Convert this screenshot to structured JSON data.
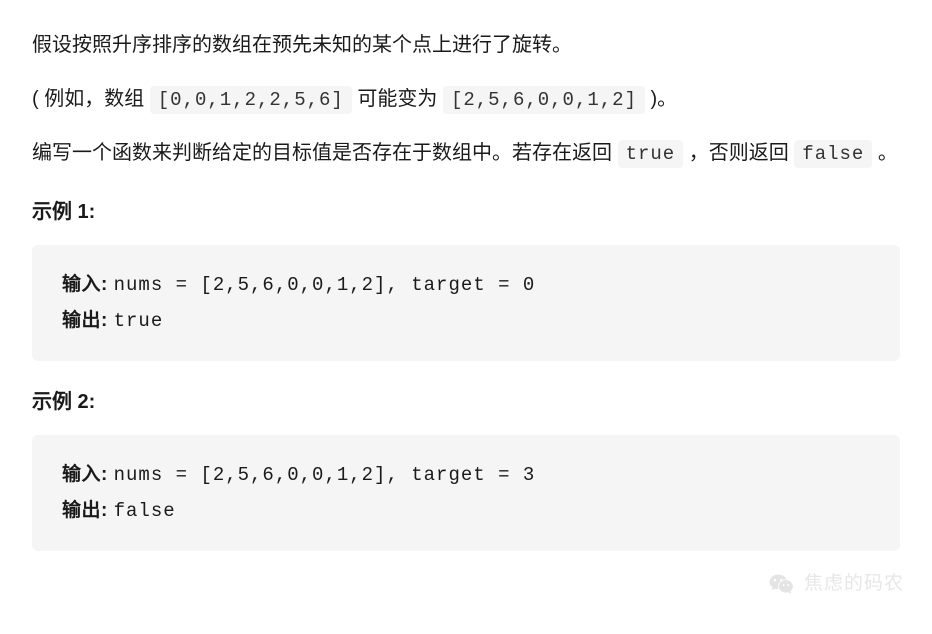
{
  "intro": {
    "p1": "假设按照升序排序的数组在预先未知的某个点上进行了旋转。",
    "p2_prefix": "( 例如，数组 ",
    "p2_arr1": "[0,0,1,2,2,5,6]",
    "p2_mid": " 可能变为 ",
    "p2_arr2": "[2,5,6,0,0,1,2]",
    "p2_suffix": " )。",
    "p3_prefix": "编写一个函数来判断给定的目标值是否存在于数组中。若存在返回 ",
    "p3_true": "true",
    "p3_mid": " ，否则返回 ",
    "p3_false": "false",
    "p3_suffix": " 。"
  },
  "examples": [
    {
      "title": "示例 1:",
      "input_label": "输入: ",
      "input_text": "nums = [2,5,6,0,0,1,2], target = 0",
      "output_label": "输出: ",
      "output_text": "true"
    },
    {
      "title": "示例 2:",
      "input_label": "输入: ",
      "input_text": "nums = [2,5,6,0,0,1,2], target = 3",
      "output_label": "输出: ",
      "output_text": "false"
    }
  ],
  "watermark": {
    "text": "焦虑的码农"
  }
}
